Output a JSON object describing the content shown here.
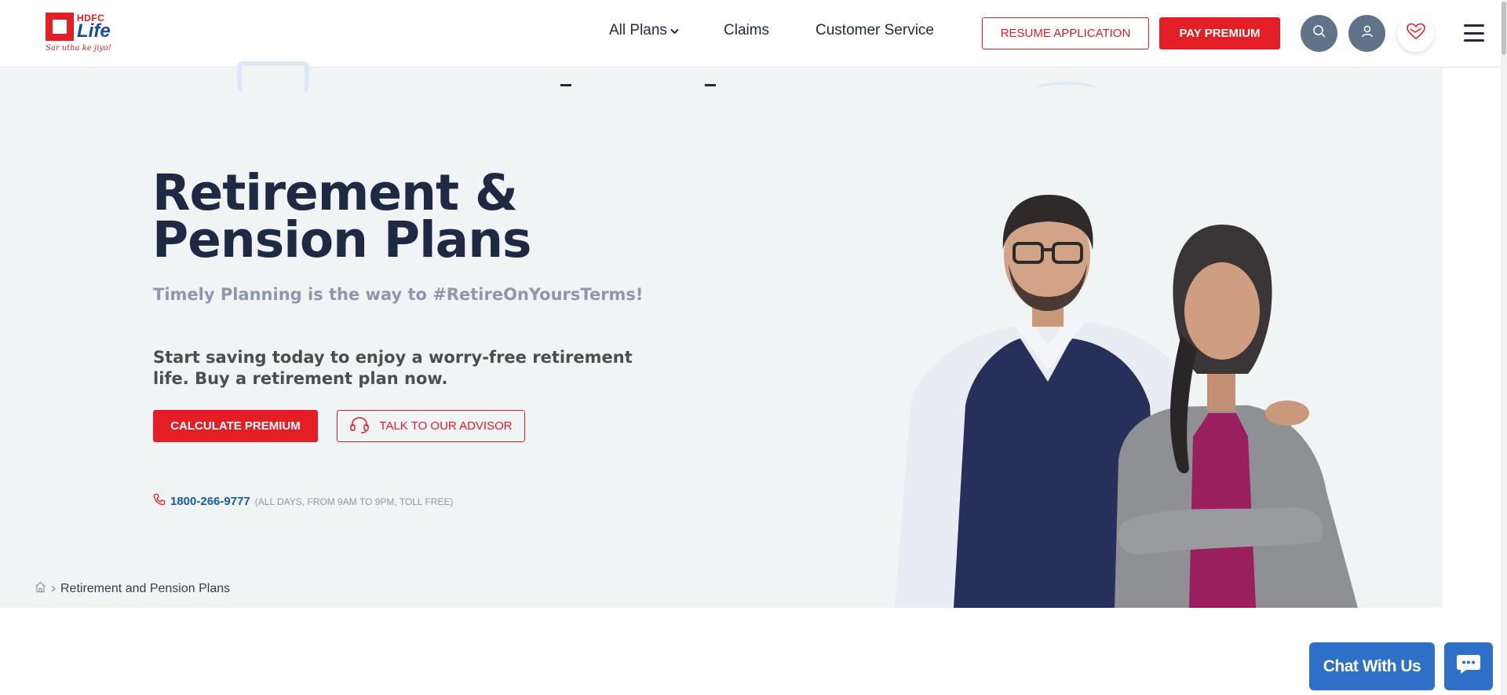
{
  "logo": {
    "brand": "HDFC",
    "name": "Life",
    "tagline": "Sar utha ke jiyo!"
  },
  "nav": {
    "all_plans": "All Plans",
    "claims": "Claims",
    "customer_service": "Customer Service"
  },
  "header_buttons": {
    "resume": "RESUME APPLICATION",
    "pay": "PAY PREMIUM"
  },
  "hero": {
    "title": "Retirement & Pension Plans",
    "subtitle": "Timely Planning is the way to #RetireOnYoursTerms!",
    "description": "Start saving today to enjoy a worry-free retirement life. Buy a retirement plan now.",
    "calc_button": "CALCULATE PREMIUM",
    "advisor_button": "TALK TO OUR ADVISOR",
    "phone": "1800-266-9777",
    "phone_note": "(ALL DAYS, FROM 9AM TO 9PM, TOLL FREE)"
  },
  "breadcrumb": {
    "current": "Retirement and Pension Plans"
  },
  "chat": {
    "label": "Chat With Us"
  },
  "icons": {
    "search": "search-icon",
    "user": "user-icon",
    "heart": "heart-icon",
    "menu": "hamburger-icon",
    "headset": "headset-icon",
    "phone": "phone-icon",
    "home": "home-icon",
    "chat": "chat-bubble-icon"
  },
  "colors": {
    "brand_red": "#e31e24",
    "navy": "#1e2a44",
    "hero_bg": "#f1f4f5",
    "chat_blue": "#2e6fc7"
  }
}
